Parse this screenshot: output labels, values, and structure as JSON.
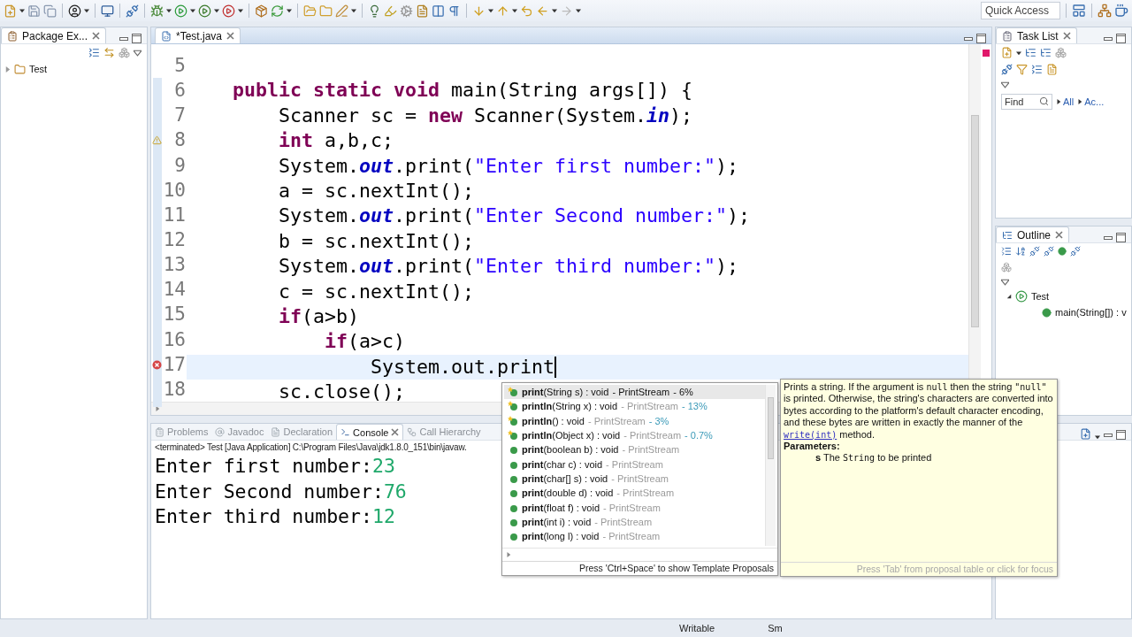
{
  "toolbar": {
    "quick_access": {
      "placeholder": "Quick Access"
    }
  },
  "package_explorer": {
    "title": "Package Ex...",
    "tree": [
      {
        "label": "Test",
        "expanded": false
      }
    ]
  },
  "editor": {
    "tab": {
      "title": "*Test.java",
      "selected": true
    },
    "lines": [
      {
        "number": "5"
      },
      {
        "number": "6",
        "tokens": [
          {
            "kind": "keyword",
            "text": "    public static void"
          },
          {
            "kind": "plain",
            "text": " main(String args[]) {"
          }
        ]
      },
      {
        "number": "7",
        "tokens": [
          {
            "kind": "plain",
            "text": "        Scanner sc = "
          },
          {
            "kind": "keyword",
            "text": "new"
          },
          {
            "kind": "plain",
            "text": " Scanner(System."
          },
          {
            "kind": "field",
            "text": "in"
          },
          {
            "kind": "plain",
            "text": ");"
          }
        ]
      },
      {
        "number": "8",
        "warning": true,
        "tokens": [
          {
            "kind": "keyword",
            "text": "        int"
          },
          {
            "kind": "plain",
            "text": " a,b,c;"
          }
        ]
      },
      {
        "number": "9",
        "tokens": [
          {
            "kind": "plain",
            "text": "        System."
          },
          {
            "kind": "field",
            "text": "out"
          },
          {
            "kind": "plain",
            "text": ".print("
          },
          {
            "kind": "string",
            "text": "\"Enter first number:\""
          },
          {
            "kind": "plain",
            "text": ");"
          }
        ]
      },
      {
        "number": "10",
        "tokens": [
          {
            "kind": "plain",
            "text": "        a = sc.nextInt();"
          }
        ]
      },
      {
        "number": "11",
        "tokens": [
          {
            "kind": "plain",
            "text": "        System."
          },
          {
            "kind": "field",
            "text": "out"
          },
          {
            "kind": "plain",
            "text": ".print("
          },
          {
            "kind": "string",
            "text": "\"Enter Second number:\""
          },
          {
            "kind": "plain",
            "text": ");"
          }
        ]
      },
      {
        "number": "12",
        "tokens": [
          {
            "kind": "plain",
            "text": "        b = sc.nextInt();"
          }
        ]
      },
      {
        "number": "13",
        "tokens": [
          {
            "kind": "plain",
            "text": "        System."
          },
          {
            "kind": "field",
            "text": "out"
          },
          {
            "kind": "plain",
            "text": ".print("
          },
          {
            "kind": "string",
            "text": "\"Enter third number:\""
          },
          {
            "kind": "plain",
            "text": ");"
          }
        ]
      },
      {
        "number": "14",
        "tokens": [
          {
            "kind": "plain",
            "text": "        c = sc.nextInt();"
          }
        ]
      },
      {
        "number": "15",
        "tokens": [
          {
            "kind": "keyword",
            "text": "        if"
          },
          {
            "kind": "plain",
            "text": "(a>b)"
          }
        ]
      },
      {
        "number": "16",
        "tokens": [
          {
            "kind": "keyword",
            "text": "            if"
          },
          {
            "kind": "plain",
            "text": "(a>c)"
          }
        ]
      },
      {
        "number": "17",
        "error": true,
        "current": true,
        "tokens": [
          {
            "kind": "plain",
            "text": "                System.out.print"
          }
        ]
      },
      {
        "number": "18",
        "tokens": [
          {
            "kind": "plain",
            "text": "        sc.close();"
          }
        ]
      }
    ]
  },
  "proposals": {
    "items": [
      {
        "label": "**print**(String s) : void",
        "owner": "- PrintStream",
        "relevance": "- 6%",
        "starred": true,
        "selected": true
      },
      {
        "label": "**println**(String x) : void",
        "owner": "- PrintStream",
        "relevance": "- 13%",
        "starred": true,
        "selected": false
      },
      {
        "label": "**println**() : void",
        "owner": "- PrintStream",
        "relevance": "- 3%",
        "starred": true,
        "selected": false
      },
      {
        "label": "**println**(Object x) : void",
        "owner": "- PrintStream",
        "relevance": "- 0.7%",
        "starred": true,
        "selected": false
      },
      {
        "label": "**print**(boolean b) : void",
        "owner": "- PrintStream",
        "starred": false,
        "selected": false
      },
      {
        "label": "**print**(char c) : void",
        "owner": "- PrintStream",
        "starred": false,
        "selected": false
      },
      {
        "label": "**print**(char[] s) : void",
        "owner": "- PrintStream",
        "starred": false,
        "selected": false
      },
      {
        "label": "**print**(double d) : void",
        "owner": "- PrintStream",
        "starred": false,
        "selected": false
      },
      {
        "label": "**print**(float f) : void",
        "owner": "- PrintStream",
        "starred": false,
        "selected": false
      },
      {
        "label": "**print**(int i) : void",
        "owner": "- PrintStream",
        "starred": false,
        "selected": false
      },
      {
        "label": "**print**(long l) : void",
        "owner": "- PrintStream",
        "starred": false,
        "selected": false
      }
    ],
    "footer": "Press 'Ctrl+Space' to show Template Proposals"
  },
  "javadoc": {
    "description": [
      {
        "kind": "text",
        "text": "Prints a string. If the argument is "
      },
      {
        "kind": "code",
        "text": "null"
      },
      {
        "kind": "text",
        "text": " then the string "
      },
      {
        "kind": "code",
        "text": "\"null\""
      },
      {
        "kind": "text",
        "text": " is printed. Otherwise, the string's characters are converted into bytes according to the platform's default character encoding, and these bytes are written in exactly the manner of the "
      },
      {
        "kind": "link",
        "text": "write(int)"
      },
      {
        "kind": "text",
        "text": " method."
      }
    ],
    "parameters_heading": "Parameters:",
    "parameters": [
      [
        {
          "kind": "bold",
          "text": "s"
        },
        {
          "kind": "text",
          "text": " The "
        },
        {
          "kind": "code",
          "text": "String"
        },
        {
          "kind": "text",
          "text": " to be printed"
        }
      ]
    ],
    "footer": "Press 'Tab' from proposal table or click for focus"
  },
  "console": {
    "tabs": [
      {
        "label": "Problems",
        "selected": false
      },
      {
        "label": "Javadoc",
        "selected": false
      },
      {
        "label": "Declaration",
        "selected": false
      },
      {
        "label": "Console",
        "selected": true
      },
      {
        "label": "Call Hierarchy",
        "selected": false
      }
    ],
    "header": "<terminated> Test [Java Application] C:\\Program Files\\Java\\jdk1.8.0_151\\bin\\javaw.",
    "lines": [
      {
        "prompt": "Enter first number:",
        "input": "23"
      },
      {
        "prompt": "Enter Second number:",
        "input": "76"
      },
      {
        "prompt": "Enter third number:",
        "input": "12"
      }
    ]
  },
  "task_list": {
    "title": "Task List",
    "find": {
      "placeholder": "Find"
    },
    "links": [
      "All",
      "Ac..."
    ]
  },
  "outline": {
    "title": "Outline",
    "tree": [
      {
        "label": "Test",
        "expanded": true,
        "children": [
          {
            "label": "main(String[]) : v"
          }
        ]
      }
    ]
  },
  "status_bar": [
    "Writable",
    "Sm"
  ]
}
